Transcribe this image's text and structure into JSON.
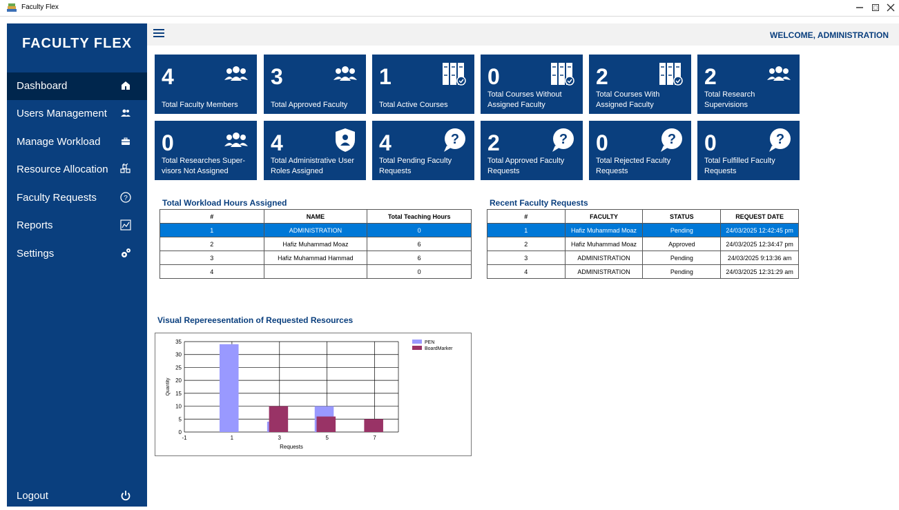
{
  "window": {
    "title": "Faculty Flex",
    "controls": [
      "minimize",
      "maximize",
      "close"
    ]
  },
  "sidebar": {
    "brand": "FACULTY FLEX",
    "items": [
      {
        "label": "Dashboard",
        "icon": "home-icon"
      },
      {
        "label": "Users Management",
        "icon": "users-icon"
      },
      {
        "label": "Manage Workload",
        "icon": "briefcase-icon"
      },
      {
        "label": "Resource Allocation",
        "icon": "boxes-icon"
      },
      {
        "label": "Faculty Requests",
        "icon": "question-icon"
      },
      {
        "label": "Reports",
        "icon": "chart-icon"
      },
      {
        "label": "Settings",
        "icon": "gears-icon"
      }
    ],
    "logout": {
      "label": "Logout",
      "icon": "power-icon"
    }
  },
  "header": {
    "welcome": "WELCOME, ADMINISTRATION"
  },
  "colors": {
    "brand": "#0a3f7e",
    "active_nav": "#00264d",
    "selected_row": "#0078d7"
  },
  "cards": [
    {
      "value": "4",
      "label": "Total Faculty Members",
      "icon": "users-icon"
    },
    {
      "value": "3",
      "label": "Total Approved Faculty",
      "icon": "users-icon"
    },
    {
      "value": "1",
      "label": "Total Active Courses",
      "icon": "books-icon"
    },
    {
      "value": "0",
      "label": "Total Courses Without Assigned Faculty",
      "icon": "books-check-icon"
    },
    {
      "value": "2",
      "label": "Total Courses With Assigned Faculty",
      "icon": "books-check-icon"
    },
    {
      "value": "2",
      "label": "Total Research Supervisions",
      "icon": "users-icon"
    },
    {
      "value": "0",
      "label": "Total Researches Super-visors Not Assigned",
      "icon": "users-icon"
    },
    {
      "value": "4",
      "label": "Total Administrative User Roles Assigned",
      "icon": "shield-user-icon"
    },
    {
      "value": "4",
      "label": "Total Pending Faculty Requests",
      "icon": "question-bubble-icon"
    },
    {
      "value": "2",
      "label": "Total Approved Faculty Requests",
      "icon": "question-bubble-icon"
    },
    {
      "value": "0",
      "label": "Total Rejected Faculty Requests",
      "icon": "question-bubble-icon"
    },
    {
      "value": "0",
      "label": "Total Fulfilled Faculty Requests",
      "icon": "question-bubble-icon"
    }
  ],
  "workload": {
    "title": "Total Workload Hours Assigned",
    "headers": [
      "#",
      "NAME",
      "Total Teaching Hours"
    ],
    "rows": [
      [
        "1",
        "ADMINISTRATION",
        "0"
      ],
      [
        "2",
        "Hafiz Muhammad Moaz",
        "6"
      ],
      [
        "3",
        "Hafiz Muhammad Hammad",
        "6"
      ],
      [
        "4",
        "",
        "0"
      ]
    ]
  },
  "requests": {
    "title": "Recent Faculty Requests",
    "headers": [
      "#",
      "FACULTY",
      "STATUS",
      "REQUEST DATE"
    ],
    "rows": [
      [
        "1",
        "Hafiz Muhammad Moaz",
        "Pending",
        "24/03/2025 12:42:45 pm"
      ],
      [
        "2",
        "Hafiz Muhammad Moaz",
        "Approved",
        "24/03/2025 12:34:47 pm"
      ],
      [
        "3",
        "ADMINISTRATION",
        "Pending",
        "24/03/2025 9:13:36 am"
      ],
      [
        "4",
        "ADMINISTRATION",
        "Pending",
        "24/03/2025 12:31:29 am"
      ]
    ]
  },
  "chart_title": "Visual Repereesentation of Requested Resources",
  "chart_data": {
    "type": "bar",
    "xlabel": "Requests",
    "ylabel": "Quantity",
    "xlim": [
      -1,
      8
    ],
    "ylim": [
      0,
      35
    ],
    "xticks": [
      "-1",
      "1",
      "3",
      "5",
      "7"
    ],
    "yticks": [
      "0",
      "5",
      "10",
      "15",
      "20",
      "25",
      "30",
      "35"
    ],
    "legend_position": "top-right",
    "series": [
      {
        "name": "PEN",
        "color": "#9999ff",
        "points": [
          {
            "x": 1,
            "y": 34
          },
          {
            "x": 3,
            "y": 4
          },
          {
            "x": 5,
            "y": 10
          }
        ]
      },
      {
        "name": "BoardMarker",
        "color": "#993366",
        "points": [
          {
            "x": 3,
            "y": 10
          },
          {
            "x": 5,
            "y": 6
          },
          {
            "x": 7,
            "y": 5
          }
        ]
      }
    ]
  }
}
